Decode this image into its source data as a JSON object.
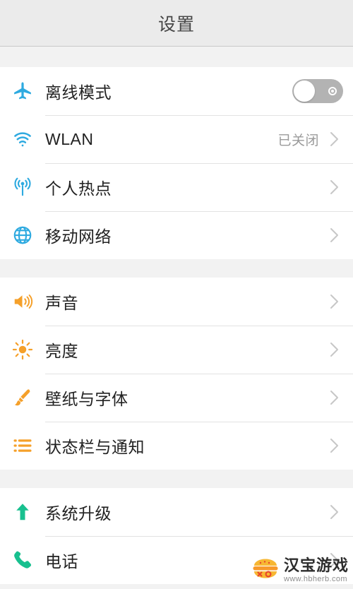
{
  "header": {
    "title": "设置"
  },
  "colors": {
    "blue": "#2eaae0",
    "orange": "#f5a02a",
    "green": "#18c08f",
    "toggle_off_track": "#b3b3b3",
    "chevron": "#c7c7c7",
    "header_bg": "#ebebeb",
    "page_bg": "#f2f2f2",
    "row_bg": "#ffffff"
  },
  "groups": [
    {
      "rows": [
        {
          "icon": "airplane-icon",
          "label": "离线模式",
          "accessory": "toggle",
          "toggle_on": false,
          "value": ""
        },
        {
          "icon": "wifi-icon",
          "label": "WLAN",
          "accessory": "chevron",
          "value": "已关闭"
        },
        {
          "icon": "hotspot-icon",
          "label": "个人热点",
          "accessory": "chevron",
          "value": ""
        },
        {
          "icon": "globe-icon",
          "label": "移动网络",
          "accessory": "chevron",
          "value": ""
        }
      ]
    },
    {
      "rows": [
        {
          "icon": "speaker-icon",
          "label": "声音",
          "accessory": "chevron",
          "value": ""
        },
        {
          "icon": "sun-icon",
          "label": "亮度",
          "accessory": "chevron",
          "value": ""
        },
        {
          "icon": "brush-icon",
          "label": "壁纸与字体",
          "accessory": "chevron",
          "value": ""
        },
        {
          "icon": "notification-lines-icon",
          "label": "状态栏与通知",
          "accessory": "chevron",
          "value": ""
        }
      ]
    },
    {
      "rows": [
        {
          "icon": "up-arrow-icon",
          "label": "系统升级",
          "accessory": "chevron",
          "value": ""
        },
        {
          "icon": "phone-icon",
          "label": "电话",
          "accessory": "chevron",
          "value": ""
        }
      ]
    }
  ],
  "watermark": {
    "name": "汉宝游戏",
    "url": "www.hbherb.com"
  }
}
